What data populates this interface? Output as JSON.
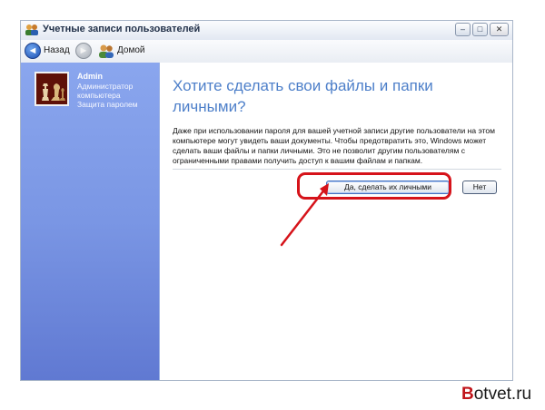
{
  "window": {
    "title": "Учетные записи пользователей",
    "controls": {
      "minimize": "–",
      "maximize": "□",
      "close": "✕"
    }
  },
  "toolbar": {
    "back_label": "Назад",
    "back_glyph": "◄",
    "forward_glyph": "►",
    "home_label": "Домой"
  },
  "sidebar": {
    "user_name": "Admin",
    "user_lines": [
      "Администратор",
      "компьютера",
      "Защита паролем"
    ]
  },
  "main": {
    "heading_line1": "Хотите сделать свои файлы и папки",
    "heading_line2": "личными?",
    "description": "Даже при использовании пароля для вашей учетной записи другие пользователи на этом компьютере могут увидеть ваши документы. Чтобы предотвратить это, Windows может сделать ваши файлы и папки личными. Это не позволит другим пользователям с ограниченными правами получить доступ к вашим файлам и папкам.",
    "yes_button": "Да, сделать их личными",
    "no_button": "Нет"
  },
  "annotation": {
    "color": "#d6131a"
  },
  "watermark": {
    "first_letter": "B",
    "rest": "otvet.ru"
  }
}
